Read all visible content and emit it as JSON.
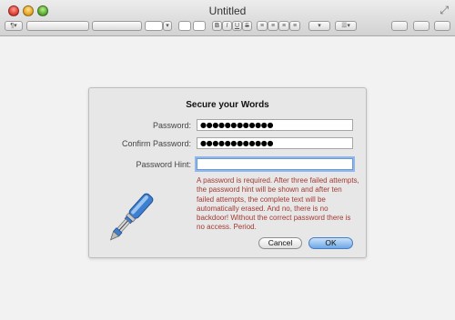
{
  "window": {
    "title": "Untitled"
  },
  "toolbar": {
    "para_style": "¶",
    "bold": "B",
    "italic": "I",
    "underline": "U",
    "strike": "S"
  },
  "dialog": {
    "title": "Secure your Words",
    "password_label": "Password:",
    "password_value": "●●●●●●●●●●●●",
    "confirm_label": "Confirm Password:",
    "confirm_value": "●●●●●●●●●●●●",
    "hint_label": "Password Hint:",
    "hint_value": "",
    "warning": "A password is required. After three failed attempts, the password hint will be shown and after ten failed attempts, the complete text will be automatically erased. And no, there is no backdoor! Without the correct password there is no access. Period.",
    "cancel_label": "Cancel",
    "ok_label": "OK"
  }
}
